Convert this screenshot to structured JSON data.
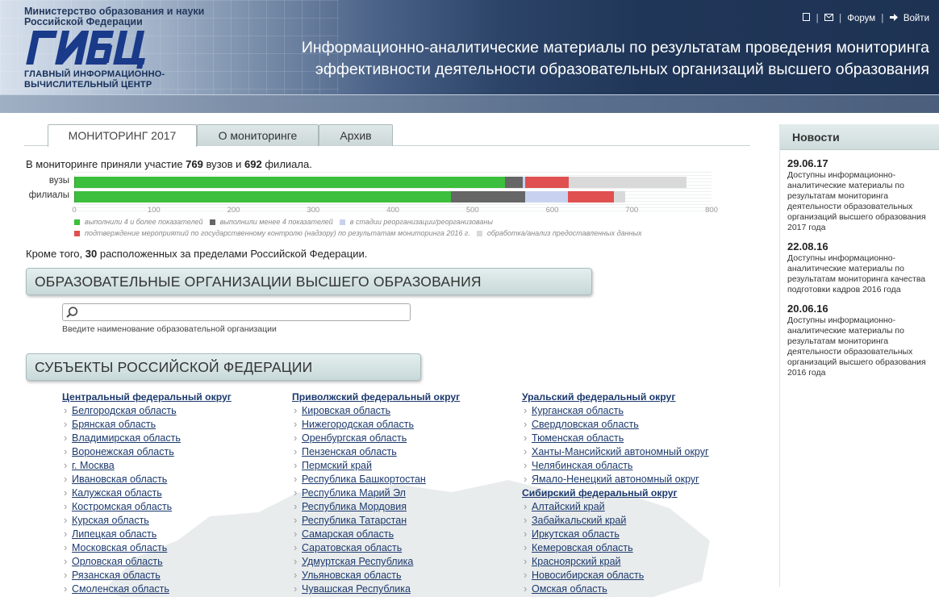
{
  "header": {
    "ministry": "Министерство образования и науки Российской Федерации",
    "logo_text": "ГИВЦ",
    "center_name": "ГЛАВНЫЙ ИНФОРМАЦИОННО-ВЫЧИСЛИТЕЛЬНЫЙ ЦЕНТР",
    "title_line1": "Информационно-аналитические материалы по результатам проведения мониторинга",
    "title_line2": "эффективности деятельности образовательных организаций высшего образования",
    "links": {
      "home_icon": "home-icon",
      "mail_icon": "mail-icon",
      "forum": "Форум",
      "logout_icon": "logout-icon",
      "logout": "Войти"
    }
  },
  "tabs": [
    {
      "label": "МОНИТОРИНГ 2017",
      "active": true
    },
    {
      "label": "О мониторинге",
      "active": false
    },
    {
      "label": "Архив",
      "active": false
    }
  ],
  "intro": {
    "prefix": "В мониторинге приняли участие ",
    "vuz_count": "769",
    "middle": " вузов и ",
    "branch_count": "692",
    "suffix": " филиала."
  },
  "chart_data": {
    "type": "bar",
    "orientation": "horizontal",
    "stacked": true,
    "categories": [
      "вузы",
      "филиалы"
    ],
    "xlim": [
      0,
      800
    ],
    "x_ticks": [
      "0",
      "100",
      "200",
      "300",
      "400",
      "500",
      "600",
      "700",
      "800"
    ],
    "series": [
      {
        "name": "выполнили 4 и более показателей",
        "color": "#3cbf3c",
        "values": [
          541,
          473
        ]
      },
      {
        "name": "выполнили менее 4 показателей",
        "color": "#666666",
        "values": [
          22,
          93
        ]
      },
      {
        "name": "в стадии реорганизации/реорганизованы",
        "color": "#c8d2f0",
        "values": [
          3,
          54
        ]
      },
      {
        "name": "подтверждение мероприятий по государственному контролю (надзору) по результатам мониторинга 2016 г.",
        "color": "#e05050",
        "values": [
          55,
          57
        ]
      },
      {
        "name": "обработка/анализ предоставленных данных",
        "color": "#d9d9d9",
        "values": [
          148,
          15
        ]
      }
    ],
    "legend_position": "bottom"
  },
  "abroad": {
    "prefix": "Кроме того, ",
    "count": "30",
    "suffix": " расположенных за пределами Российской Федерации."
  },
  "orgs_section": {
    "title": "ОБРАЗОВАТЕЛЬНЫЕ ОРГАНИЗАЦИИ ВЫСШЕГО ОБРАЗОВАНИЯ",
    "search_placeholder": "",
    "search_hint": "Введите наименование образовательной организации"
  },
  "subjects_section": {
    "title": "СУБЪЕКТЫ РОССИЙСКОЙ ФЕДЕРАЦИИ"
  },
  "columns": [
    {
      "groups": [
        {
          "district": "Центральный федеральный округ",
          "regions": [
            "Белгородская область",
            "Брянская область",
            "Владимирская область",
            "Воронежская область",
            "г. Москва",
            "Ивановская область",
            "Калужская область",
            "Костромская область",
            "Курская область",
            "Липецкая область",
            "Московская область",
            "Орловская область",
            "Рязанская область",
            "Смоленская область"
          ]
        }
      ]
    },
    {
      "groups": [
        {
          "district": "Приволжский федеральный округ",
          "regions": [
            "Кировская область",
            "Нижегородская область",
            "Оренбургская область",
            "Пензенская область",
            "Пермский край",
            "Республика Башкортостан",
            "Республика Марий Эл",
            "Республика Мордовия",
            "Республика Татарстан",
            "Самарская область",
            "Саратовская область",
            "Удмуртская Республика",
            "Ульяновская область",
            "Чувашская Республика"
          ]
        }
      ]
    },
    {
      "groups": [
        {
          "district": "Уральский федеральный округ",
          "regions": [
            "Курганская область",
            "Свердловская область",
            "Тюменская область",
            "Ханты-Мансийский автономный округ",
            "Челябинская область",
            "Ямало-Ненецкий автономный округ"
          ]
        },
        {
          "district": "Сибирский федеральный округ",
          "regions": [
            "Алтайский край",
            "Забайкальский край",
            "Иркутская область",
            "Кемеровская область",
            "Красноярский край",
            "Новосибирская область",
            "Омская область"
          ]
        }
      ]
    }
  ],
  "sidebar": {
    "title": "Новости",
    "news": [
      {
        "date": "29.06.17",
        "text": "Доступны информационно-аналитические материалы по результатам мониторинга деятельности образовательных организаций высшего образования 2017 года"
      },
      {
        "date": "22.08.16",
        "text": "Доступны информационно-аналитические материалы по результатам мониторинга качества подготовки кадров 2016 года"
      },
      {
        "date": "20.06.16",
        "text": "Доступны информационно-аналитические материалы по результатам мониторинга деятельности образовательных организаций высшего образования 2016 года"
      }
    ]
  }
}
